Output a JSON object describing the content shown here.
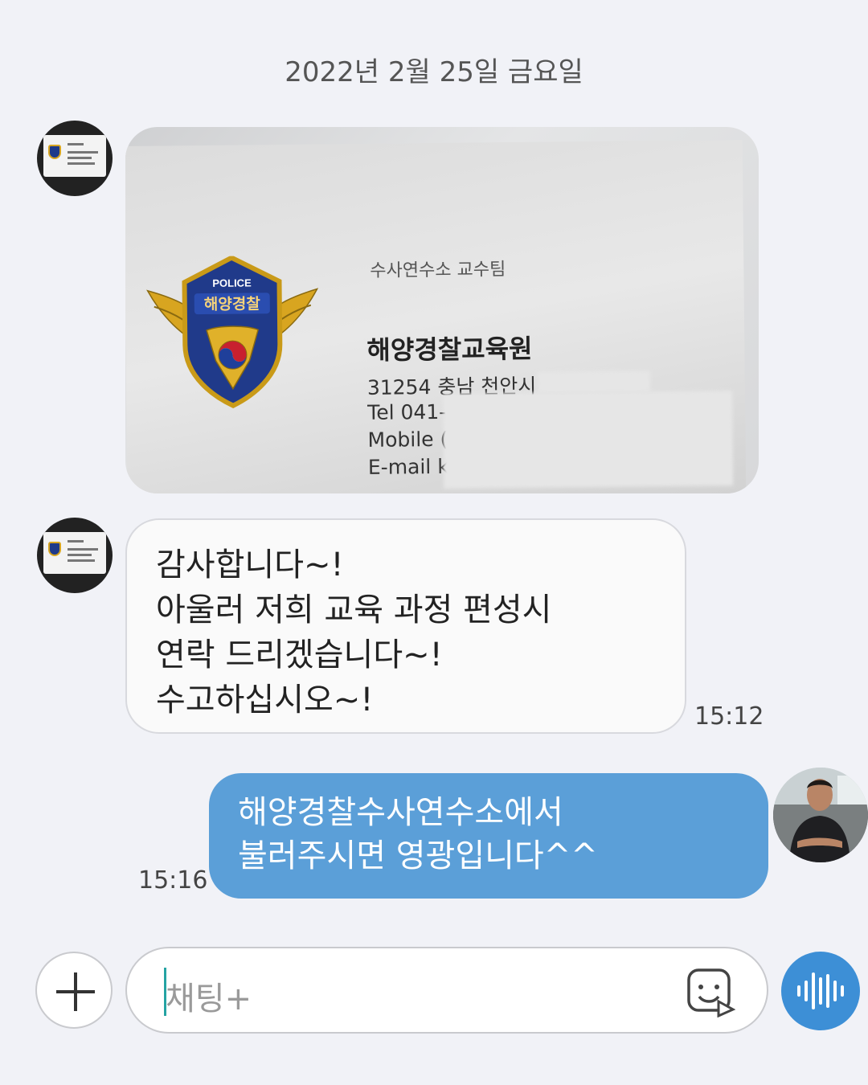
{
  "date_header": "2022년 2월 25일 금요일",
  "business_card": {
    "emblem_top_text": "POLICE",
    "emblem_main_text": "해양경찰",
    "department": "수사연수소 교수팀",
    "organization": "해양경찰교육원",
    "address": "31254 충남 천안시",
    "tel": "Tel 041-",
    "mobile": "Mobile (",
    "email": "E-mail k"
  },
  "messages": {
    "received": {
      "lines": [
        "감사합니다~!",
        "아울러 저희 교육 과정 편성시",
        "연락 드리겠습니다~!",
        "수고하십시오~!"
      ],
      "time": "15:12"
    },
    "sent": {
      "lines": [
        "해양경찰수사연수소에서",
        "불러주시면 영광입니다^^"
      ],
      "time": "15:16"
    }
  },
  "input": {
    "placeholder": "채팅+"
  },
  "icons": {
    "plus": "plus-icon",
    "emoji": "emoticon-icon",
    "voice": "voice-wave-icon"
  },
  "colors": {
    "background": "#f1f2f7",
    "sent_bubble": "#5b9fd8",
    "voice_button": "#3d8fd6"
  }
}
